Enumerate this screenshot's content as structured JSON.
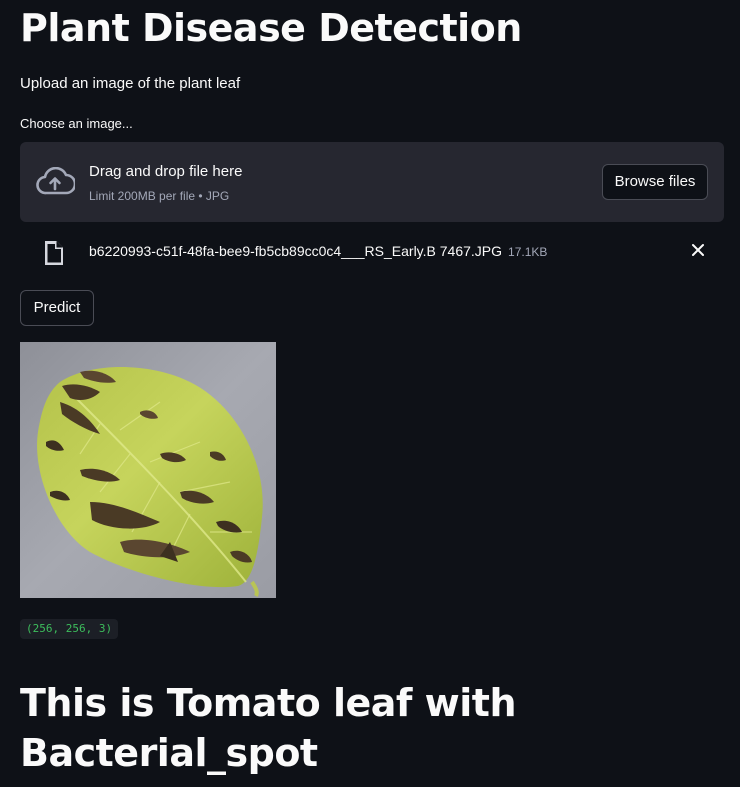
{
  "header": {
    "title": "Plant Disease Detection",
    "subtitle": "Upload an image of the plant leaf"
  },
  "uploader": {
    "label": "Choose an image...",
    "drop_title": "Drag and drop file here",
    "drop_limit": "Limit 200MB per file • JPG",
    "browse_label": "Browse files",
    "upload_icon": "cloud-upload-icon"
  },
  "uploaded_file": {
    "name": "b6220993-c51f-48fa-bee9-fb5cb89cc0c4___RS_Early.B 7467.JPG",
    "size": "17.1KB",
    "file_icon": "file-icon",
    "remove_icon": "close-icon"
  },
  "actions": {
    "predict_label": "Predict"
  },
  "image_info": {
    "shape": "(256, 256, 3)"
  },
  "result": {
    "text": "This is Tomato leaf with Bacterial_spot"
  },
  "colors": {
    "background": "#0e1117",
    "dropzone": "#262730",
    "text": "#fafafa",
    "muted_text": "#a3a8b8",
    "code_text": "#3dbd5c"
  }
}
